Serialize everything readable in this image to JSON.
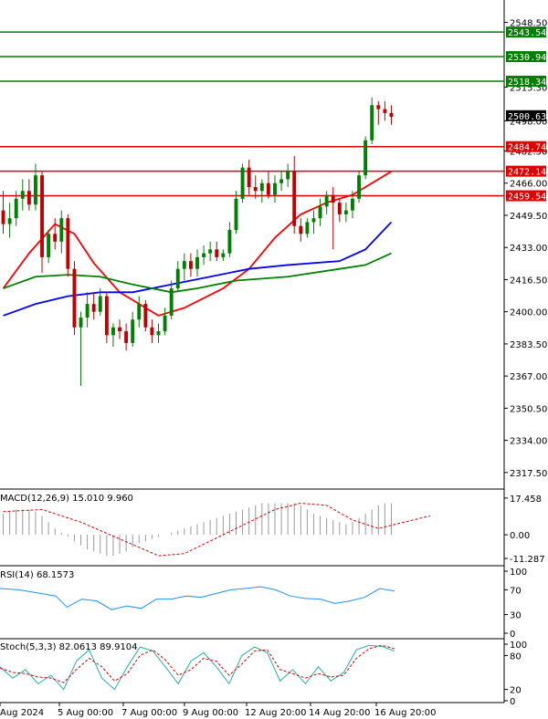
{
  "chart_data": {
    "type": "candlestick",
    "x_ticks": [
      "Aug 2024",
      "5 Aug 00:00",
      "7 Aug 00:00",
      "9 Aug 00:00",
      "12 Aug 20:00",
      "14 Aug 20:00",
      "16 Aug 20:00"
    ],
    "y_ticks": [
      2548.5,
      2515.3,
      2498.0,
      2482.5,
      2466.0,
      2449.5,
      2433.0,
      2416.5,
      2400.0,
      2383.5,
      2367.0,
      2350.5,
      2334.0,
      2317.5
    ],
    "ylim": [
      2309,
      2560
    ],
    "horizontal_levels": [
      {
        "value": 2543.54,
        "label": "2543.54",
        "color": "#008000"
      },
      {
        "value": 2530.94,
        "label": "2530.94",
        "color": "#008000"
      },
      {
        "value": 2518.34,
        "label": "2518.34",
        "color": "#008000"
      },
      {
        "value": 2484.74,
        "label": "2484.74",
        "color": "#e00000"
      },
      {
        "value": 2472.14,
        "label": "2472.14",
        "color": "#e00000"
      },
      {
        "value": 2459.54,
        "label": "2459.54",
        "color": "#e00000"
      }
    ],
    "current_price": {
      "value": 2500.63,
      "label": "2500.63"
    },
    "candles": [
      [
        2452,
        2462,
        2440,
        2445
      ],
      [
        2445,
        2456,
        2438,
        2448
      ],
      [
        2448,
        2462,
        2444,
        2458
      ],
      [
        2458,
        2468,
        2452,
        2462
      ],
      [
        2462,
        2468,
        2452,
        2455
      ],
      [
        2455,
        2476,
        2452,
        2470
      ],
      [
        2470,
        2472,
        2420,
        2428
      ],
      [
        2428,
        2442,
        2425,
        2440
      ],
      [
        2440,
        2448,
        2432,
        2436
      ],
      [
        2436,
        2452,
        2430,
        2448
      ],
      [
        2448,
        2450,
        2418,
        2422
      ],
      [
        2422,
        2426,
        2388,
        2392
      ],
      [
        2392,
        2400,
        2362,
        2397
      ],
      [
        2397,
        2410,
        2392,
        2404
      ],
      [
        2404,
        2410,
        2396,
        2400
      ],
      [
        2400,
        2412,
        2398,
        2408
      ],
      [
        2408,
        2410,
        2384,
        2388
      ],
      [
        2388,
        2394,
        2382,
        2392
      ],
      [
        2392,
        2396,
        2386,
        2390
      ],
      [
        2390,
        2394,
        2380,
        2384
      ],
      [
        2384,
        2400,
        2382,
        2396
      ],
      [
        2396,
        2408,
        2392,
        2404
      ],
      [
        2404,
        2406,
        2390,
        2392
      ],
      [
        2392,
        2396,
        2384,
        2388
      ],
      [
        2388,
        2394,
        2384,
        2390
      ],
      [
        2390,
        2402,
        2388,
        2398
      ],
      [
        2398,
        2416,
        2396,
        2412
      ],
      [
        2412,
        2426,
        2410,
        2422
      ],
      [
        2422,
        2430,
        2416,
        2426
      ],
      [
        2426,
        2430,
        2418,
        2422
      ],
      [
        2422,
        2432,
        2418,
        2428
      ],
      [
        2428,
        2434,
        2424,
        2430
      ],
      [
        2430,
        2436,
        2426,
        2432
      ],
      [
        2432,
        2436,
        2426,
        2428
      ],
      [
        2428,
        2432,
        2426,
        2430
      ],
      [
        2430,
        2446,
        2428,
        2442
      ],
      [
        2442,
        2462,
        2440,
        2458
      ],
      [
        2458,
        2476,
        2456,
        2474
      ],
      [
        2474,
        2478,
        2460,
        2464
      ],
      [
        2464,
        2470,
        2458,
        2462
      ],
      [
        2462,
        2468,
        2456,
        2466
      ],
      [
        2466,
        2472,
        2458,
        2460
      ],
      [
        2460,
        2470,
        2456,
        2466
      ],
      [
        2466,
        2472,
        2462,
        2468
      ],
      [
        2468,
        2476,
        2464,
        2472
      ],
      [
        2472,
        2480,
        2440,
        2444
      ],
      [
        2444,
        2448,
        2436,
        2440
      ],
      [
        2440,
        2448,
        2438,
        2446
      ],
      [
        2446,
        2452,
        2440,
        2448
      ],
      [
        2448,
        2458,
        2444,
        2454
      ],
      [
        2454,
        2462,
        2450,
        2460
      ],
      [
        2460,
        2464,
        2432,
        2456
      ],
      [
        2456,
        2458,
        2446,
        2450
      ],
      [
        2450,
        2456,
        2446,
        2452
      ],
      [
        2452,
        2462,
        2448,
        2458
      ],
      [
        2458,
        2472,
        2456,
        2470
      ],
      [
        2470,
        2490,
        2468,
        2488
      ],
      [
        2488,
        2510,
        2486,
        2506
      ],
      [
        2506,
        2508,
        2496,
        2504
      ],
      [
        2504,
        2508,
        2498,
        2502
      ],
      [
        2502,
        2506,
        2496,
        2500
      ]
    ],
    "moving_averages": [
      {
        "color": "#ff0000",
        "values": [
          [
            0,
            2412
          ],
          [
            4,
            2430
          ],
          [
            8,
            2445
          ],
          [
            11,
            2440
          ],
          [
            14,
            2425
          ],
          [
            18,
            2410
          ],
          [
            24,
            2398
          ],
          [
            28,
            2402
          ],
          [
            34,
            2412
          ],
          [
            38,
            2422
          ],
          [
            42,
            2438
          ],
          [
            46,
            2450
          ],
          [
            50,
            2456
          ],
          [
            54,
            2460
          ],
          [
            60,
            2472
          ]
        ]
      },
      {
        "color": "#0000ff",
        "values": [
          [
            0,
            2398
          ],
          [
            5,
            2404
          ],
          [
            10,
            2408
          ],
          [
            15,
            2410
          ],
          [
            20,
            2410
          ],
          [
            26,
            2414
          ],
          [
            32,
            2418
          ],
          [
            38,
            2422
          ],
          [
            44,
            2424
          ],
          [
            52,
            2426
          ],
          [
            56,
            2432
          ],
          [
            60,
            2446
          ]
        ]
      },
      {
        "color": "#008000",
        "values": [
          [
            0,
            2412
          ],
          [
            5,
            2418
          ],
          [
            10,
            2419
          ],
          [
            15,
            2418
          ],
          [
            20,
            2414
          ],
          [
            26,
            2410
          ],
          [
            30,
            2412
          ],
          [
            36,
            2416
          ],
          [
            44,
            2418
          ],
          [
            52,
            2422
          ],
          [
            56,
            2424
          ],
          [
            60,
            2430
          ]
        ]
      }
    ],
    "macd": {
      "title": "MACD(12,26,9) 15.010 9.960",
      "y_ticks": [
        17.458,
        0.0,
        -11.287
      ],
      "ylim": [
        -13.0,
        20.0
      ],
      "histogram": [
        10,
        11,
        12,
        12,
        12,
        11,
        9,
        6,
        3,
        1,
        -1,
        -3,
        -5,
        -7,
        -8,
        -9,
        -10,
        -10,
        -9,
        -8,
        -6,
        -4,
        -3,
        -2,
        -1,
        0,
        1,
        2,
        3,
        4,
        5,
        6,
        7,
        8,
        9,
        10,
        11,
        12,
        13,
        14,
        15,
        15,
        15,
        15,
        15,
        15,
        14,
        12,
        10,
        9,
        8,
        7,
        6,
        5,
        6,
        8,
        10,
        12,
        14,
        15,
        15
      ],
      "signal": [
        [
          0,
          11
        ],
        [
          6,
          12
        ],
        [
          12,
          6
        ],
        [
          18,
          -2
        ],
        [
          24,
          -10
        ],
        [
          28,
          -9
        ],
        [
          34,
          0
        ],
        [
          42,
          12
        ],
        [
          46,
          15
        ],
        [
          50,
          14
        ],
        [
          54,
          7
        ],
        [
          58,
          3
        ],
        [
          62,
          6
        ],
        [
          66,
          9
        ]
      ]
    },
    "rsi": {
      "title": "RSI(14) 68.1573",
      "y_ticks": [
        100,
        70,
        30,
        0
      ],
      "ylim": [
        0,
        100
      ],
      "values": [
        [
          0,
          72
        ],
        [
          5,
          70
        ],
        [
          10,
          65
        ],
        [
          15,
          60
        ],
        [
          18,
          42
        ],
        [
          22,
          55
        ],
        [
          26,
          52
        ],
        [
          30,
          38
        ],
        [
          34,
          44
        ],
        [
          38,
          40
        ],
        [
          42,
          55
        ],
        [
          46,
          55
        ],
        [
          50,
          60
        ],
        [
          54,
          58
        ],
        [
          58,
          64
        ],
        [
          62,
          70
        ],
        [
          66,
          72
        ],
        [
          70,
          75
        ],
        [
          74,
          70
        ],
        [
          78,
          60
        ],
        [
          82,
          56
        ],
        [
          86,
          55
        ],
        [
          90,
          48
        ],
        [
          94,
          52
        ],
        [
          98,
          58
        ],
        [
          102,
          72
        ],
        [
          106,
          68
        ]
      ]
    },
    "stochastic": {
      "title": "Stoch(5,3,3) 82.0613 89.9104",
      "y_ticks": [
        100,
        80,
        20,
        0
      ],
      "ylim": [
        0,
        100
      ],
      "k": [
        [
          0,
          60
        ],
        [
          3,
          40
        ],
        [
          6,
          55
        ],
        [
          9,
          30
        ],
        [
          12,
          45
        ],
        [
          15,
          20
        ],
        [
          18,
          70
        ],
        [
          21,
          90
        ],
        [
          24,
          40
        ],
        [
          27,
          20
        ],
        [
          30,
          60
        ],
        [
          33,
          95
        ],
        [
          36,
          88
        ],
        [
          39,
          60
        ],
        [
          42,
          30
        ],
        [
          45,
          70
        ],
        [
          48,
          85
        ],
        [
          51,
          60
        ],
        [
          54,
          30
        ],
        [
          57,
          80
        ],
        [
          60,
          95
        ],
        [
          63,
          85
        ],
        [
          66,
          35
        ],
        [
          69,
          55
        ],
        [
          72,
          30
        ],
        [
          75,
          60
        ],
        [
          78,
          35
        ],
        [
          81,
          50
        ],
        [
          84,
          90
        ],
        [
          87,
          98
        ],
        [
          90,
          96
        ],
        [
          93,
          88
        ]
      ],
      "d": [
        [
          0,
          58
        ],
        [
          3,
          50
        ],
        [
          6,
          48
        ],
        [
          9,
          42
        ],
        [
          12,
          40
        ],
        [
          15,
          32
        ],
        [
          18,
          55
        ],
        [
          21,
          75
        ],
        [
          24,
          60
        ],
        [
          27,
          35
        ],
        [
          30,
          48
        ],
        [
          33,
          80
        ],
        [
          36,
          90
        ],
        [
          39,
          72
        ],
        [
          42,
          45
        ],
        [
          45,
          55
        ],
        [
          48,
          75
        ],
        [
          51,
          70
        ],
        [
          54,
          45
        ],
        [
          57,
          65
        ],
        [
          60,
          88
        ],
        [
          63,
          90
        ],
        [
          66,
          55
        ],
        [
          69,
          48
        ],
        [
          72,
          40
        ],
        [
          75,
          48
        ],
        [
          78,
          42
        ],
        [
          81,
          45
        ],
        [
          84,
          75
        ],
        [
          87,
          92
        ],
        [
          90,
          98
        ],
        [
          93,
          92
        ]
      ]
    }
  }
}
